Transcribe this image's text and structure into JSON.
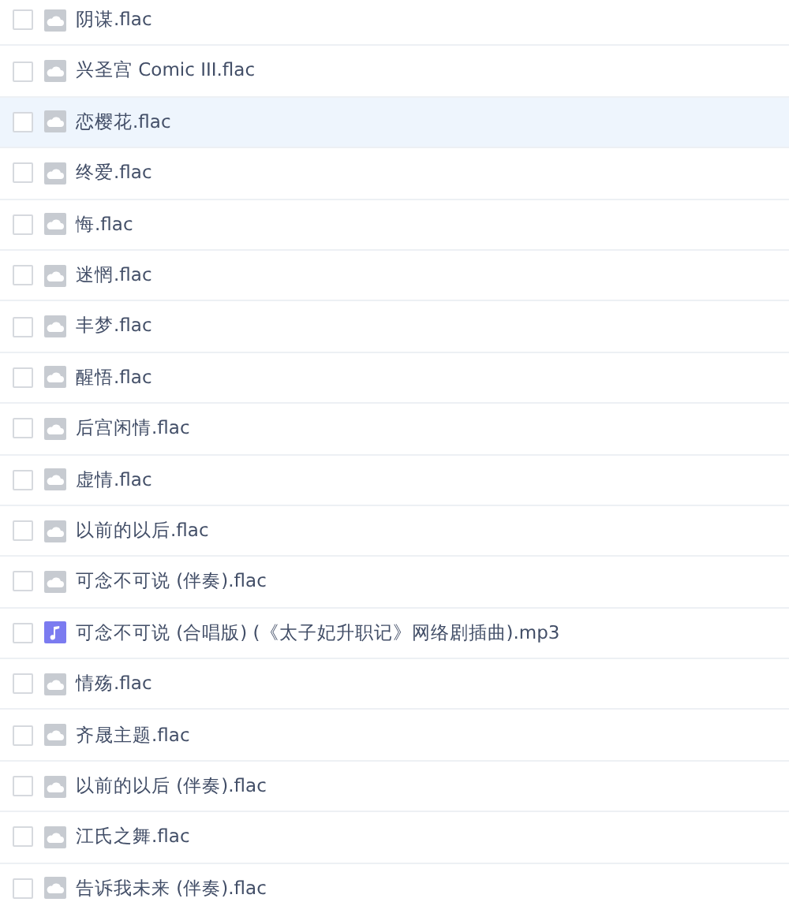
{
  "files": [
    {
      "name": "阴谋.flac",
      "kind": "file",
      "checked": false,
      "selected": false
    },
    {
      "name": "兴圣宫 Comic III.flac",
      "kind": "file",
      "checked": false,
      "selected": false
    },
    {
      "name": "恋樱花.flac",
      "kind": "file",
      "checked": false,
      "selected": true
    },
    {
      "name": "终爱.flac",
      "kind": "file",
      "checked": false,
      "selected": false
    },
    {
      "name": "悔.flac",
      "kind": "file",
      "checked": false,
      "selected": false
    },
    {
      "name": "迷惘.flac",
      "kind": "file",
      "checked": false,
      "selected": false
    },
    {
      "name": "丰梦.flac",
      "kind": "file",
      "checked": false,
      "selected": false
    },
    {
      "name": "醒悟.flac",
      "kind": "file",
      "checked": false,
      "selected": false
    },
    {
      "name": "后宫闲情.flac",
      "kind": "file",
      "checked": false,
      "selected": false
    },
    {
      "name": "虚情.flac",
      "kind": "file",
      "checked": false,
      "selected": false
    },
    {
      "name": "以前的以后.flac",
      "kind": "file",
      "checked": false,
      "selected": false
    },
    {
      "name": "可念不可说 (伴奏).flac",
      "kind": "file",
      "checked": false,
      "selected": false
    },
    {
      "name": "可念不可说 (合唱版) (《太子妃升职记》网络剧插曲).mp3",
      "kind": "audio",
      "checked": false,
      "selected": false
    },
    {
      "name": "情殇.flac",
      "kind": "file",
      "checked": false,
      "selected": false
    },
    {
      "name": "齐晟主题.flac",
      "kind": "file",
      "checked": false,
      "selected": false
    },
    {
      "name": "以前的以后 (伴奏).flac",
      "kind": "file",
      "checked": false,
      "selected": false
    },
    {
      "name": "江氏之舞.flac",
      "kind": "file",
      "checked": false,
      "selected": false
    },
    {
      "name": "告诉我未来 (伴奏).flac",
      "kind": "file",
      "checked": false,
      "selected": false
    }
  ]
}
